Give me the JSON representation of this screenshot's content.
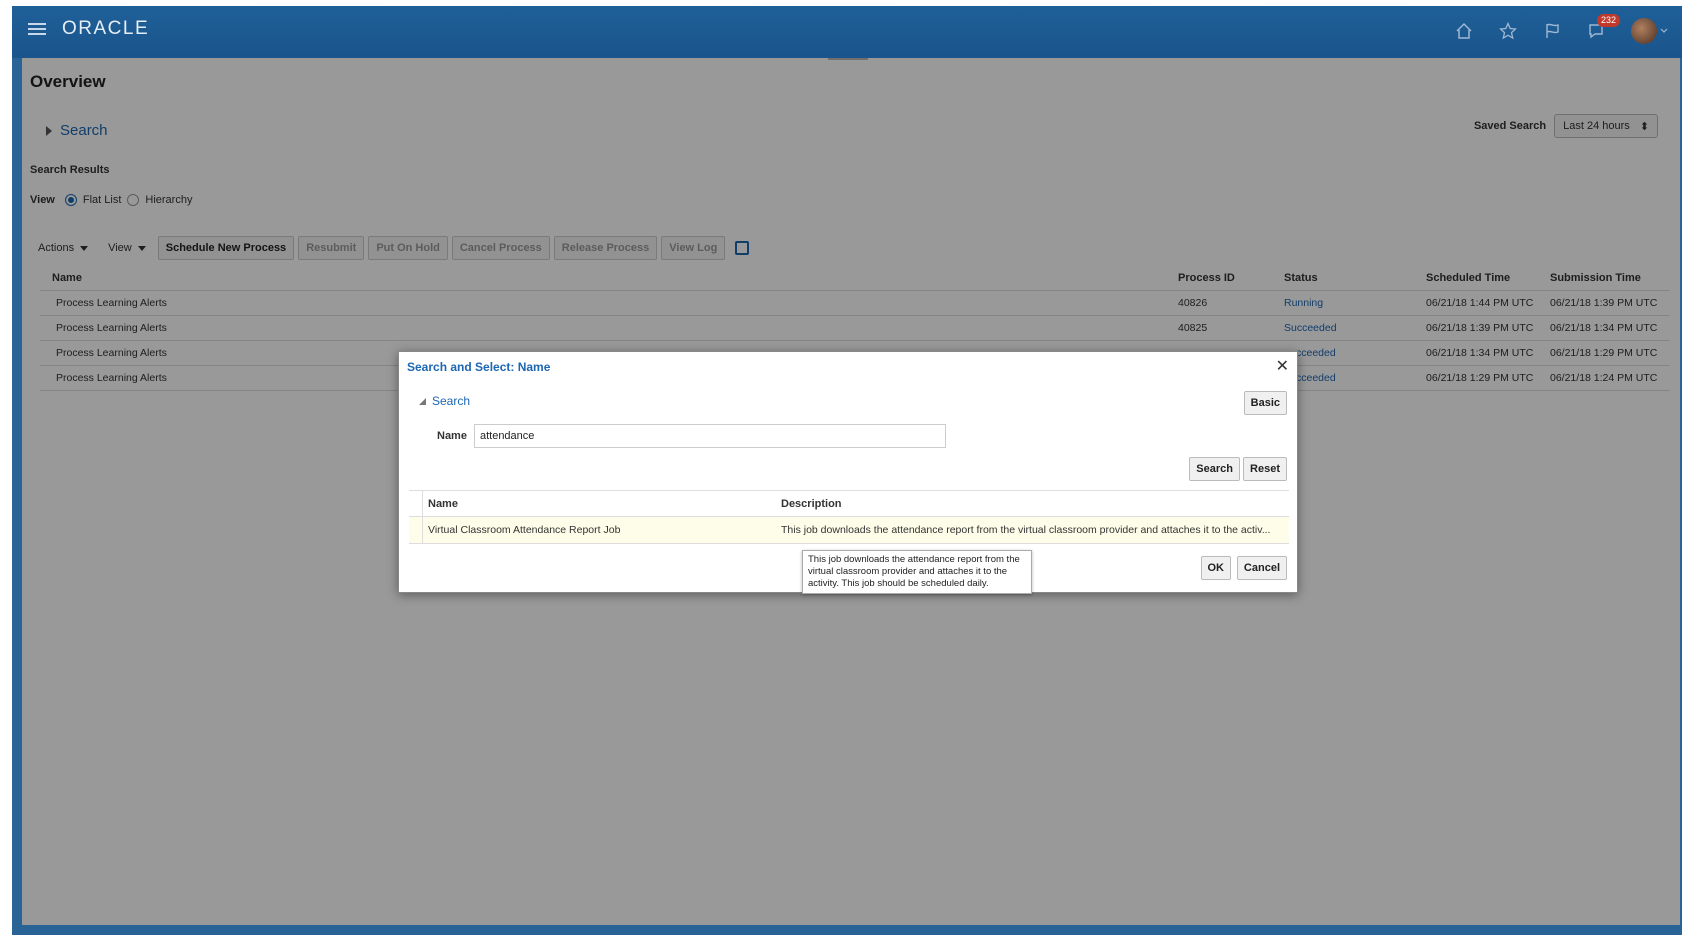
{
  "header": {
    "logo": "ORACLE",
    "notification_count": "232",
    "icons": [
      "hamburger-icon",
      "home-icon",
      "star-icon",
      "flag-icon",
      "notifications-icon",
      "avatar-icon"
    ]
  },
  "page": {
    "title": "Overview",
    "search_label": "Search",
    "saved_search_label": "Saved Search",
    "saved_search_value": "Last 24 hours",
    "results_label": "Search Results",
    "view_label": "View",
    "view_options": [
      "Flat List",
      "Hierarchy"
    ]
  },
  "toolbar": {
    "actions": "Actions",
    "view": "View",
    "schedule": "Schedule New Process",
    "resubmit": "Resubmit",
    "hold": "Put On Hold",
    "cancel": "Cancel Process",
    "release": "Release Process",
    "viewlog": "View Log"
  },
  "table": {
    "columns": [
      "Name",
      "Process ID",
      "Status",
      "Scheduled Time",
      "Submission Time"
    ],
    "rows": [
      [
        "Process Learning Alerts",
        "40826",
        "Running",
        "06/21/18 1:44 PM UTC",
        "06/21/18 1:39 PM UTC"
      ],
      [
        "Process Learning Alerts",
        "40825",
        "Succeeded",
        "06/21/18 1:39 PM UTC",
        "06/21/18 1:34 PM UTC"
      ],
      [
        "Process Learning Alerts",
        "",
        "cceeded",
        "06/21/18 1:34 PM UTC",
        "06/21/18 1:29 PM UTC"
      ],
      [
        "Process Learning Alerts",
        "",
        "cceeded",
        "06/21/18 1:29 PM UTC",
        "06/21/18 1:24 PM UTC"
      ]
    ]
  },
  "dialog": {
    "title": "Search and Select: Name",
    "search_label": "Search",
    "basic_button": "Basic",
    "name_label": "Name",
    "name_value": "attendance",
    "search_button": "Search",
    "reset_button": "Reset",
    "columns": [
      "Name",
      "Description"
    ],
    "result_name": "Virtual Classroom Attendance Report Job",
    "result_desc": "This job downloads the attendance report from the virtual classroom provider and attaches it to the activ...",
    "ok_button": "OK",
    "cancel_button": "Cancel",
    "tooltip": "This job downloads the attendance report from the virtual classroom provider and attaches it to the activity. This job should be scheduled daily."
  },
  "colors": {
    "brand_bar": "#1f5f98",
    "link": "#1d66b2",
    "selected_row": "#fdfde9",
    "badge": "#c0392b"
  }
}
